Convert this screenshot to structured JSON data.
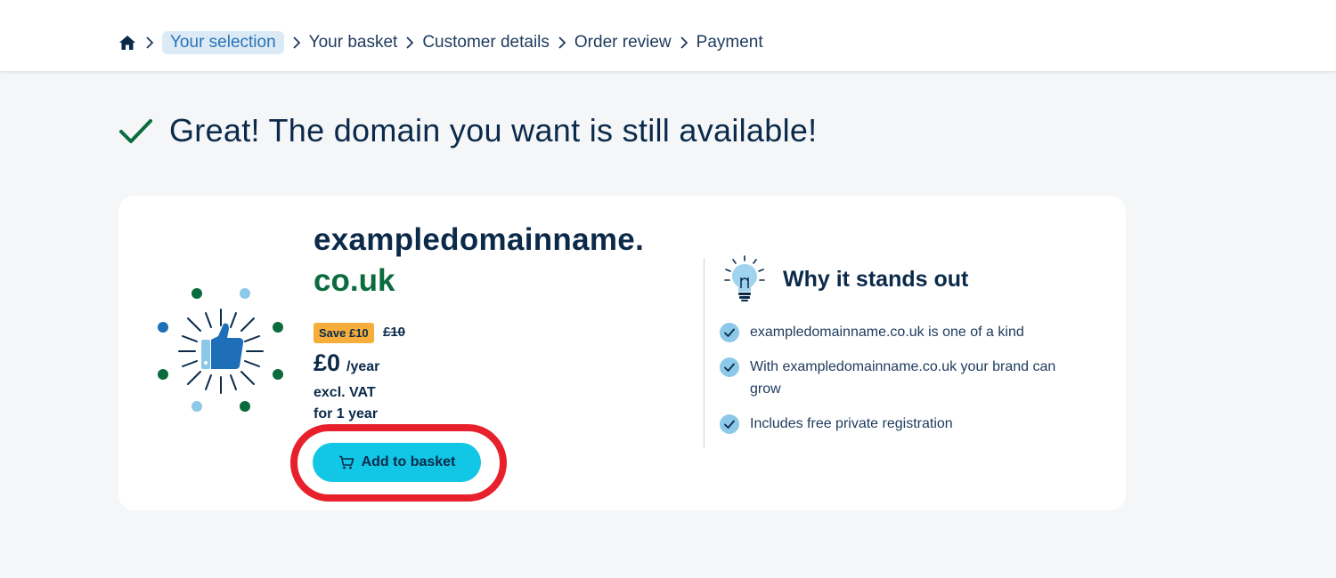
{
  "breadcrumb": {
    "home_icon": "home-icon",
    "items": [
      "Your selection",
      "Your basket",
      "Customer details",
      "Order review",
      "Payment"
    ],
    "active_index": 0
  },
  "headline": {
    "icon": "check-icon",
    "text": "Great! The domain you want is still available!"
  },
  "domain": {
    "name": "exampledomainname.",
    "tld": "co.uk",
    "illustration": "thumbs-up-icon"
  },
  "pricing": {
    "save_badge": "Save £10",
    "old_price": "£10",
    "price": "£0",
    "period": "/year",
    "vat_note": "excl. VAT",
    "term": "for 1 year"
  },
  "actions": {
    "add_to_basket": "Add to basket",
    "add_icon": "cart-icon"
  },
  "why": {
    "icon": "lightbulb-icon",
    "title": "Why it stands out",
    "items": [
      "exampledomainname.co.uk is one of a kind",
      "With exampledomainname.co.uk your brand can grow",
      "Includes free private registration"
    ]
  },
  "colors": {
    "accent": "#12c6e6",
    "tld_green": "#0a6b3d",
    "badge_orange": "#f6ad3c",
    "highlight_red": "#e8202b",
    "text_dark": "#0b2a4a"
  }
}
